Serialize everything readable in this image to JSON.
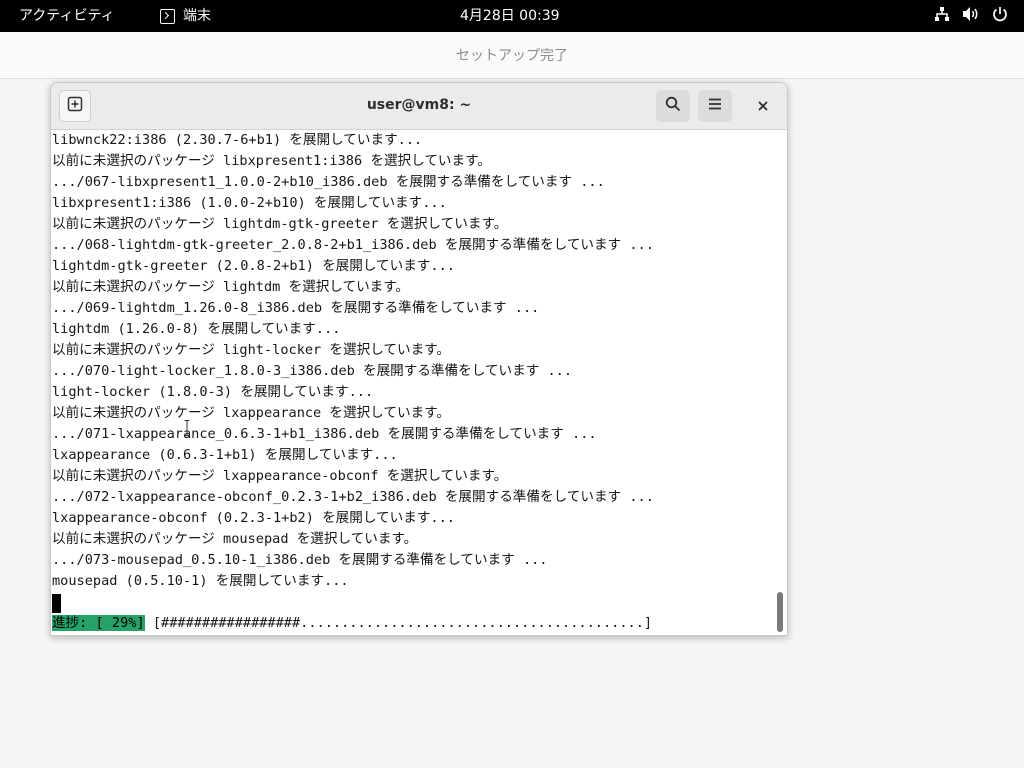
{
  "topbar": {
    "activities": "アクティビティ",
    "app_name": "端末",
    "app_icon": "terminal-icon",
    "clock": "4月28日  00:39",
    "icons": [
      "network-icon",
      "volume-icon",
      "power-icon"
    ]
  },
  "setup_window": {
    "title": "セットアップ完了"
  },
  "terminal_window": {
    "title": "user@vm8: ~",
    "buttons": {
      "new_tab_icon": "new-tab-icon",
      "search_icon": "search-icon",
      "menu_icon": "hamburger-menu-icon",
      "close_icon": "close-icon"
    }
  },
  "terminal": {
    "lines": [
      "libwnck22:i386 (2.30.7-6+b1) を展開しています...",
      "以前に未選択のパッケージ libxpresent1:i386 を選択しています。",
      ".../067-libxpresent1_1.0.0-2+b10_i386.deb を展開する準備をしています ...",
      "libxpresent1:i386 (1.0.0-2+b10) を展開しています...",
      "以前に未選択のパッケージ lightdm-gtk-greeter を選択しています。",
      ".../068-lightdm-gtk-greeter_2.0.8-2+b1_i386.deb を展開する準備をしています ...",
      "lightdm-gtk-greeter (2.0.8-2+b1) を展開しています...",
      "以前に未選択のパッケージ lightdm を選択しています。",
      ".../069-lightdm_1.26.0-8_i386.deb を展開する準備をしています ...",
      "lightdm (1.26.0-8) を展開しています...",
      "以前に未選択のパッケージ light-locker を選択しています。",
      ".../070-light-locker_1.8.0-3_i386.deb を展開する準備をしています ...",
      "light-locker (1.8.0-3) を展開しています...",
      "以前に未選択のパッケージ lxappearance を選択しています。",
      ".../071-lxappearance_0.6.3-1+b1_i386.deb を展開する準備をしています ...",
      "lxappearance (0.6.3-1+b1) を展開しています...",
      "以前に未選択のパッケージ lxappearance-obconf を選択しています。",
      ".../072-lxappearance-obconf_0.2.3-1+b2_i386.deb を展開する準備をしています ...",
      "lxappearance-obconf (0.2.3-1+b2) を展開しています...",
      "以前に未選択のパッケージ mousepad を選択しています。",
      ".../073-mousepad_0.5.10-1_i386.deb を展開する準備をしています ...",
      "mousepad (0.5.10-1) を展開しています..."
    ],
    "progress_label": "進捗: [ 29%]",
    "progress_bar": " [#################..........................................]",
    "progress_percent": 29,
    "progress_color": "#26a269"
  }
}
